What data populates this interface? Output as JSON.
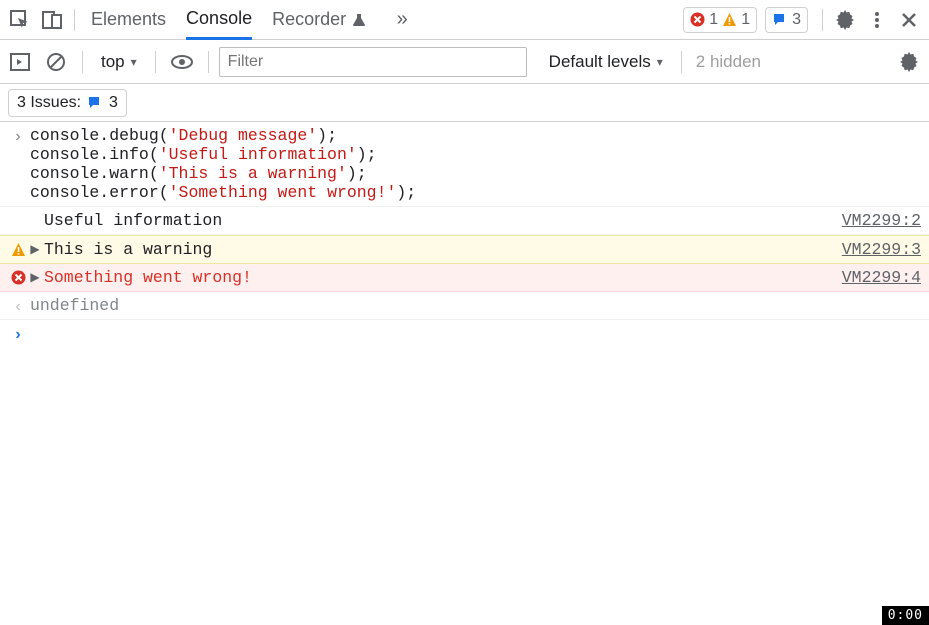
{
  "topbar": {
    "tabs": {
      "elements": "Elements",
      "console": "Console",
      "recorder": "Recorder"
    },
    "errorCount": "1",
    "warnCount": "1",
    "issueCount": "3"
  },
  "consolebar": {
    "context": "top",
    "filterPlaceholder": "Filter",
    "levels": "Default levels",
    "hidden": "2 hidden"
  },
  "issuesbar": {
    "label": "3 Issues:",
    "count": "3"
  },
  "input": {
    "lines": [
      {
        "fn": "console.debug",
        "arg": "'Debug message'",
        "tail": ");",
        "prefix": "("
      },
      {
        "fn": "console.info",
        "arg": "'Useful information'",
        "tail": ");",
        "prefix": "("
      },
      {
        "fn": "console.warn",
        "arg": "'This is a warning'",
        "tail": ");",
        "prefix": "("
      },
      {
        "fn": "console.error",
        "arg": "'Something went wrong!'",
        "tail": ");",
        "prefix": "("
      }
    ]
  },
  "logs": {
    "info": {
      "msg": "Useful information",
      "src": "VM2299:2"
    },
    "warn": {
      "msg": "This is a warning",
      "src": "VM2299:3"
    },
    "error": {
      "msg": "Something went wrong!",
      "src": "VM2299:4"
    },
    "ret": "undefined"
  },
  "clock": "0:00"
}
